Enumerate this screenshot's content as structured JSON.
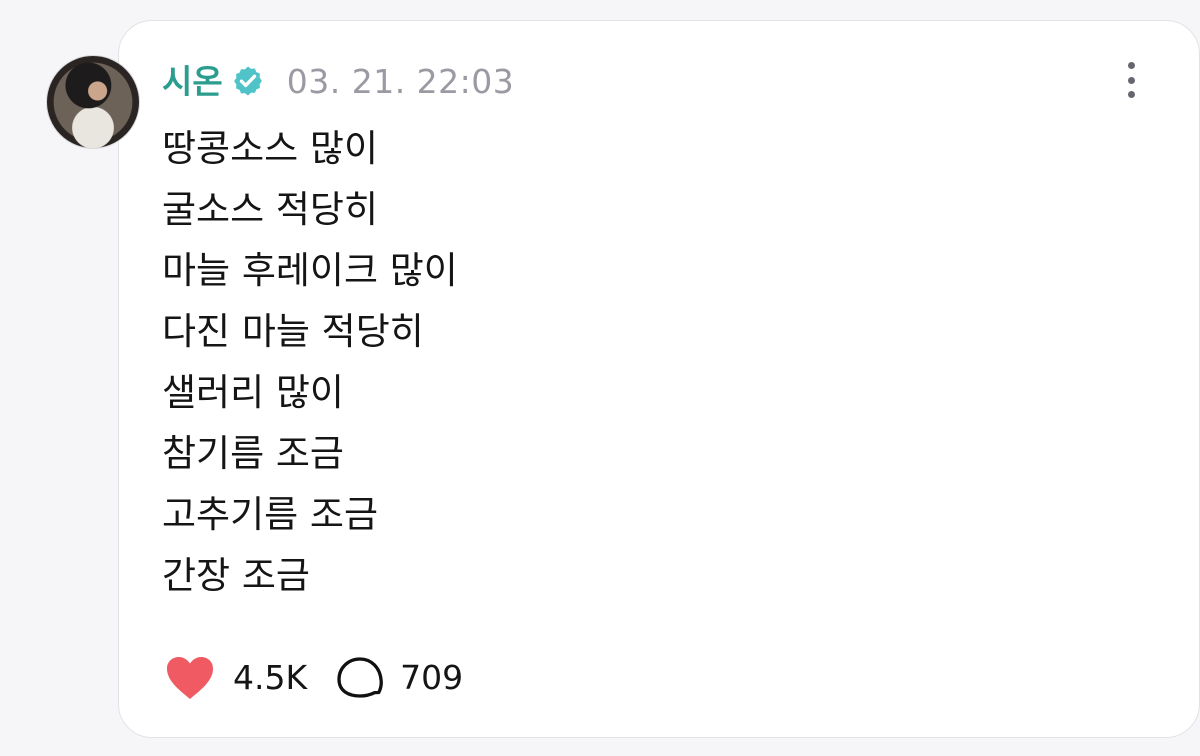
{
  "post": {
    "author": {
      "name": "시온",
      "verified_icon": "verified-badge-icon",
      "avatar_icon": "profile-avatar"
    },
    "timestamp": "03. 21. 22:03",
    "menu_icon": "more-vertical-icon",
    "lines": [
      "땅콩소스 많이",
      "굴소스 적당히",
      "마늘 후레이크 많이",
      "다진 마늘 적당히",
      "샐러리 많이",
      "참기름 조금",
      "고추기름 조금",
      "간장 조금"
    ],
    "stats": {
      "likes": "4.5K",
      "comments": "709"
    },
    "colors": {
      "author_name": "#2a9d8f",
      "verified_badge": "#4fc3c8",
      "timestamp": "#9a9aa3",
      "heart": "#ef5a63"
    }
  }
}
